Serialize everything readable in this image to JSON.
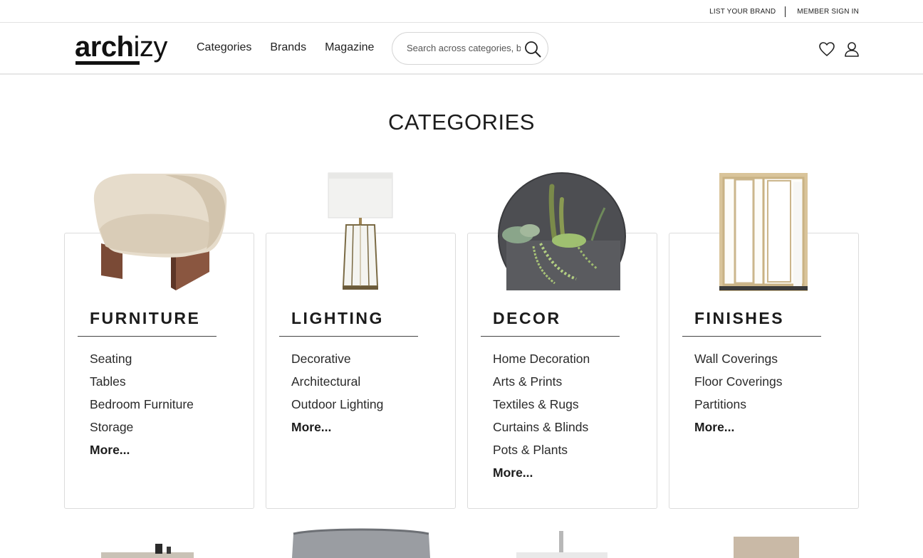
{
  "topbar": {
    "list_brand": "LIST YOUR BRAND",
    "member_sign_in": "MEMBER SIGN IN"
  },
  "header": {
    "logo_bold": "arch",
    "logo_light": "izy",
    "nav": [
      "Categories",
      "Brands",
      "Magazine"
    ],
    "search_placeholder": "Search across categories, brands",
    "icons": [
      "search-icon",
      "heart-icon",
      "user-icon"
    ]
  },
  "page": {
    "title": "CATEGORIES"
  },
  "categories": [
    {
      "title": "FURNITURE",
      "image": "armchair",
      "items": [
        "Seating",
        "Tables",
        "Bedroom Furniture",
        "Storage"
      ],
      "more": "More..."
    },
    {
      "title": "LIGHTING",
      "image": "table-lamp",
      "items": [
        "Decorative",
        "Architectural",
        "Outdoor Lighting"
      ],
      "more": "More..."
    },
    {
      "title": "DECOR",
      "image": "wall-planter",
      "items": [
        "Home Decoration",
        "Arts & Prints",
        "Textiles & Rugs",
        "Curtains & Blinds",
        "Pots & Plants"
      ],
      "more": "More..."
    },
    {
      "title": "FINISHES",
      "image": "sliding-door",
      "items": [
        "Wall Coverings",
        "Floor Coverings",
        "Partitions"
      ],
      "more": "More..."
    }
  ],
  "colors": {
    "text": "#222222",
    "border": "#dcdcdc",
    "accent": "#111111"
  }
}
